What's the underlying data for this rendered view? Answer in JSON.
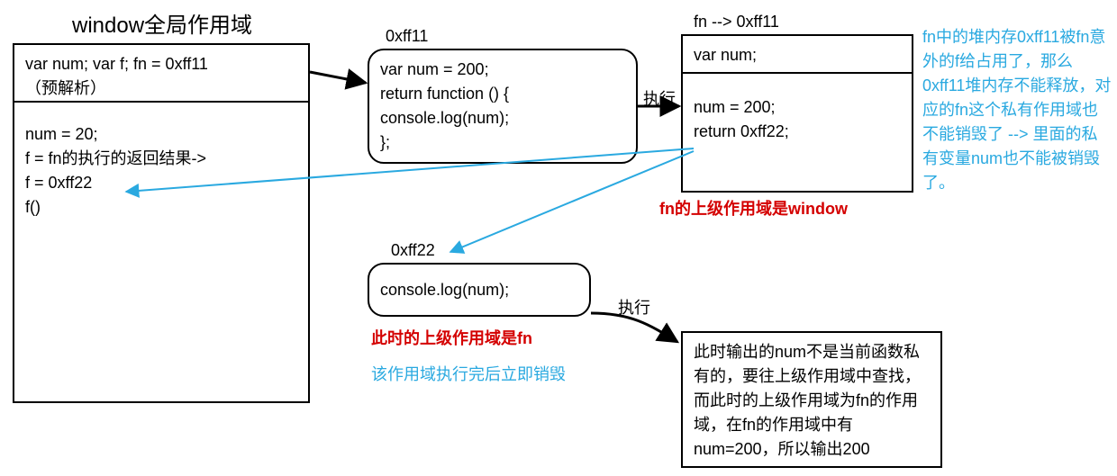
{
  "title": "window全局作用域",
  "window_box": {
    "header": "var num; var f; fn = 0xff11\n（预解析）",
    "body": [
      "num = 20;",
      "f = fn的执行的返回结果->",
      "f = 0xff22",
      "",
      "f()"
    ]
  },
  "fn_def": {
    "label": "0xff11",
    "body": [
      "var num = 200;",
      "return function () {",
      "        console.log(num);",
      "};"
    ]
  },
  "fn_exec": {
    "label": "fn --> 0xff11",
    "header": "var num;",
    "body": [
      "num = 200;",
      "return 0xff22;"
    ],
    "note": "fn的上级作用域是window"
  },
  "inner_fn": {
    "label": "0xff22",
    "body": "console.log(num);",
    "note_red": "此时的上级作用域是fn",
    "note_cyan": "该作用域执行完后立即销毁"
  },
  "result_box": {
    "text": "此时输出的num不是当前函数私有的，要往上级作用域中查找，而此时的上级作用域为fn的作用域，在fn的作用域中有num=200，所以输出200"
  },
  "side_note": {
    "text": "fn中的堆内存0xff11被fn意外的f给占用了，那么0xff11堆内存不能释放，对应的fn这个私有作用域也不能销毁了 --> 里面的私有变量num也不能被销毁了。"
  },
  "exec_labels": {
    "exec1": "执行",
    "exec2": "执行"
  }
}
